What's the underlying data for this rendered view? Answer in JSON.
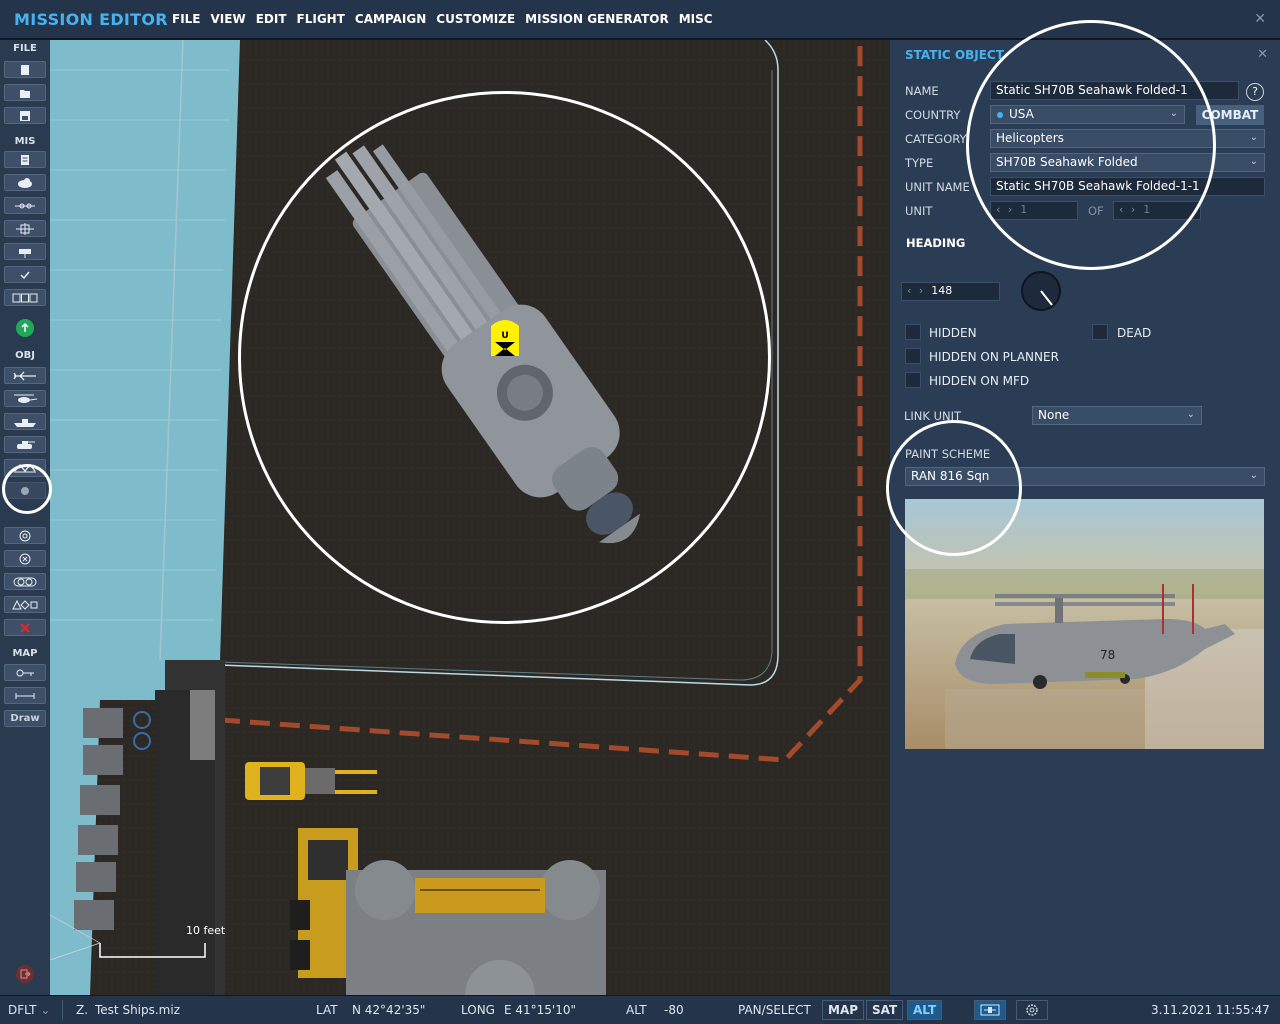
{
  "app": {
    "title": "MISSION EDITOR",
    "menu": [
      "FILE",
      "VIEW",
      "EDIT",
      "FLIGHT",
      "CAMPAIGN",
      "CUSTOMIZE",
      "MISSION GENERATOR",
      "MISC"
    ],
    "close_icon": "✕"
  },
  "toolbar": {
    "sections": {
      "file": "FILE",
      "mis": "MIS",
      "obj": "OBJ",
      "map": "MAP"
    },
    "draw_label": "Draw",
    "icons": {
      "file": [
        "new-file-icon",
        "open-file-icon",
        "save-file-icon"
      ],
      "mis": [
        "briefing-icon",
        "weather-icon",
        "triggers-icon",
        "trigger-zone-icon",
        "goals-icon",
        "check-icon",
        "resources-icon"
      ],
      "obj": [
        "aircraft-icon",
        "helicopter-icon",
        "ship-icon",
        "ground-unit-icon",
        "static-object-icon",
        "template-icon",
        "airfield-icon",
        "nav-point-icon",
        "target-icon",
        "layers-icon",
        "shapes-icon",
        "delete-icon"
      ],
      "map": [
        "key-icon",
        "ruler-icon"
      ]
    }
  },
  "map": {
    "scale_label": "10 feet",
    "unit_marker_letter": "U",
    "unit_marker_color": "#fff200"
  },
  "panel": {
    "title": "STATIC OBJECT",
    "close_icon": "✕",
    "help_label": "?",
    "name_label": "NAME",
    "name_value": "Static SH70B Seahawk Folded-1",
    "country_label": "COUNTRY",
    "country_value": "USA",
    "combat_label": "COMBAT",
    "category_label": "CATEGORY",
    "category_value": "Helicopters",
    "type_label": "TYPE",
    "type_value": "SH70B Seahawk Folded",
    "unit_name_label": "UNIT NAME",
    "unit_name_value": "Static SH70B Seahawk Folded-1-1",
    "unit_label": "UNIT",
    "unit_value": "1",
    "of_label": "OF",
    "of_value": "1",
    "heading_label": "HEADING",
    "heading_value": "148",
    "hidden_label": "HIDDEN",
    "dead_label": "DEAD",
    "hidden_planner_label": "HIDDEN ON PLANNER",
    "hidden_mfd_label": "HIDDEN ON MFD",
    "link_unit_label": "LINK UNIT",
    "link_unit_value": "None",
    "paint_label": "PAINT SCHEME",
    "paint_value": "RAN 816 Sqn",
    "preview_tail_number": "78"
  },
  "status": {
    "profile": "DFLT",
    "zoom": "Z.",
    "file": "Test Ships.miz",
    "lat_label": "LAT",
    "lat_value": "N 42°42'35\"",
    "long_label": "LONG",
    "long_value": "E 41°15'10\"",
    "alt_label": "ALT",
    "alt_value": "-80",
    "mode": "PAN/SELECT",
    "map_btn": "MAP",
    "sat_btn": "SAT",
    "alt_btn": "ALT",
    "datetime": "3.11.2021 11:55:47"
  },
  "colors": {
    "accent": "#46b3f0",
    "panel": "#2b3d54",
    "deck": "#2b2824",
    "water": "#7fbccb",
    "delete": "#e02a2a",
    "go": "#1fa85a"
  }
}
